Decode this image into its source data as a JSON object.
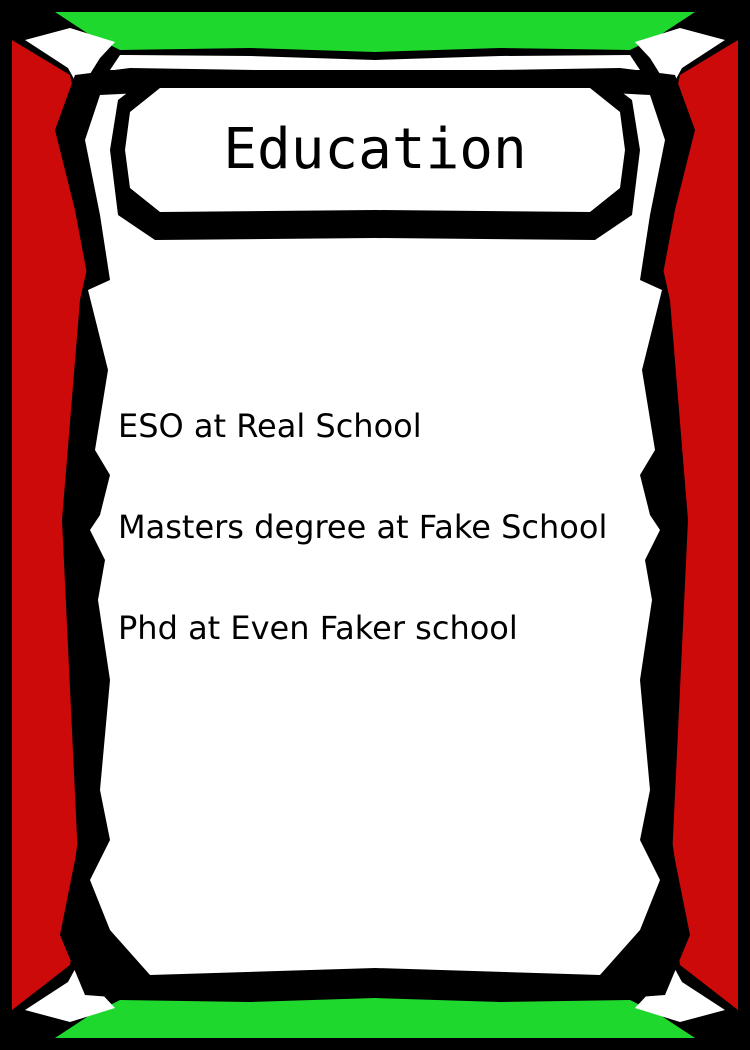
{
  "card": {
    "title": "Education",
    "items": [
      "ESO at Real School",
      "Masters degree at Fake School",
      "Phd at Even Faker school"
    ]
  },
  "colors": {
    "background": "#000000",
    "side_panels": "#cc0a0a",
    "top_bottom_bands": "#1fd82d",
    "frame_white": "#ffffff",
    "text": "#000000"
  }
}
